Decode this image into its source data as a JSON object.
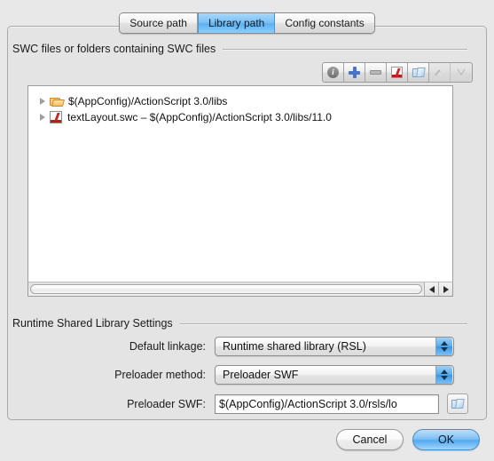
{
  "tabs": [
    {
      "label": "Source path",
      "active": false
    },
    {
      "label": "Library path",
      "active": true
    },
    {
      "label": "Config constants",
      "active": false
    }
  ],
  "swc_group": {
    "title": "SWC files or folders containing SWC files",
    "toolbar": [
      {
        "name": "info-icon",
        "label": "i",
        "disabled": false
      },
      {
        "name": "add-icon",
        "label": "+",
        "disabled": false
      },
      {
        "name": "remove-icon",
        "label": "-",
        "disabled": false
      },
      {
        "name": "swc-icon",
        "label": "",
        "disabled": false
      },
      {
        "name": "folder-icon",
        "label": "",
        "disabled": false
      },
      {
        "name": "move-up-icon",
        "label": "",
        "disabled": true
      },
      {
        "name": "move-down-icon",
        "label": "",
        "disabled": true
      }
    ],
    "rows": [
      {
        "icon": "folder-open-icon",
        "text": "$(AppConfig)/ActionScript 3.0/libs"
      },
      {
        "icon": "swc-file-icon",
        "text": "textLayout.swc – $(AppConfig)/ActionScript 3.0/libs/11.0"
      }
    ]
  },
  "rsl_group": {
    "title": "Runtime Shared Library Settings",
    "default_linkage": {
      "label": "Default linkage:",
      "value": "Runtime shared library (RSL)"
    },
    "preloader_method": {
      "label": "Preloader method:",
      "value": "Preloader SWF"
    },
    "preloader_swf": {
      "label": "Preloader SWF:",
      "value": "$(AppConfig)/ActionScript 3.0/rsls/lo"
    }
  },
  "buttons": {
    "cancel": "Cancel",
    "ok": "OK"
  },
  "colors": {
    "accent": "#5bb2f3",
    "window_bg": "#e8e8e8",
    "list_bg": "#ffffff"
  }
}
